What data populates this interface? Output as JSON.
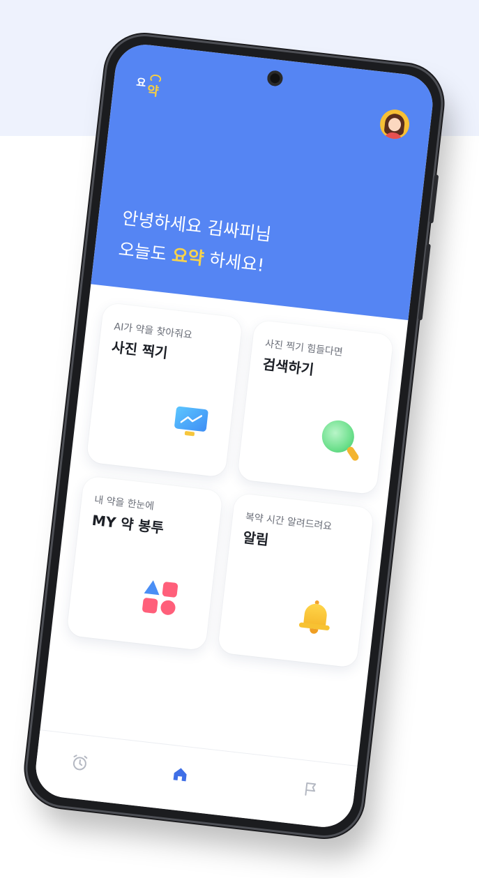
{
  "app": {
    "logo_yo": "요",
    "logo_yak": "약"
  },
  "header": {
    "greeting_line1": "안녕하세요 김싸피님",
    "greeting_line2_prefix": "오늘도",
    "greeting_line2_highlight": "요약",
    "greeting_line2_suffix": "하세요!"
  },
  "cards": [
    {
      "subtitle": "AI가 약을 찾아줘요",
      "title": "사진 찍기",
      "icon": "monitor-chart-icon"
    },
    {
      "subtitle": "사진 찍기 힘들다면",
      "title": "검색하기",
      "icon": "magnifier-icon"
    },
    {
      "subtitle": "내 약을 한눈에",
      "title": "MY 약 봉투",
      "icon": "shapes-icon"
    },
    {
      "subtitle": "복약 시간 알려드려요",
      "title": "알림",
      "icon": "bell-icon"
    }
  ],
  "tabbar": {
    "items": [
      {
        "icon": "alarm-clock-icon",
        "active": false
      },
      {
        "icon": "home-icon",
        "active": true
      },
      {
        "icon": "flag-icon",
        "active": false
      }
    ]
  },
  "colors": {
    "hero": "#5585f3",
    "highlight": "#f8d34b",
    "active_tab": "#3f6fe6",
    "inactive_tab": "#b4b8c2"
  }
}
